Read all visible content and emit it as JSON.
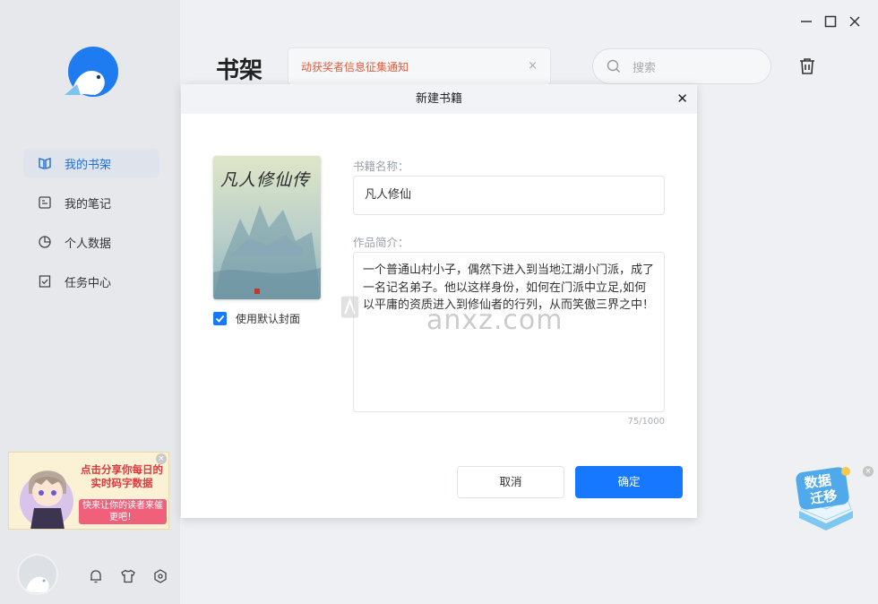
{
  "sidebar": {
    "nav": [
      {
        "label": "我的书架",
        "icon": "bookshelf-icon",
        "active": true
      },
      {
        "label": "我的笔记",
        "icon": "notes-icon",
        "active": false
      },
      {
        "label": "个人数据",
        "icon": "pie-chart-icon",
        "active": false
      },
      {
        "label": "任务中心",
        "icon": "task-icon",
        "active": false
      }
    ],
    "ad": {
      "headline": "点击分享你每日的实时码字数据",
      "button_text": "快来让你的读者来催更吧！"
    },
    "bottom_icons": [
      "bell-icon",
      "shirt-icon",
      "settings-hex-icon"
    ]
  },
  "main": {
    "title": "书架",
    "notice": "动获奖者信息征集通知",
    "search_placeholder": "搜索"
  },
  "dialog": {
    "title": "新建书籍",
    "cover_title": "凡人修仙传",
    "use_default_cover_label": "使用默认封面",
    "use_default_cover_checked": true,
    "name_label": "书籍名称：",
    "name_value": "凡人修仙",
    "intro_label": "作品简介：",
    "intro_value": "一个普通山村小子，偶然下进入到当地江湖小门派，成了一名记名弟子。他以这样身份，如何在门派中立足,如何以平庸的资质进入到修仙者的行列，从而笑傲三界之中！",
    "char_count": "75/1000",
    "cancel_label": "取消",
    "ok_label": "确定"
  },
  "migrate_badge": "数据迁移",
  "watermark": "anxz.com",
  "colors": {
    "accent": "#1677ff",
    "notice": "#e25a3a",
    "active_nav": "#1e6fd9"
  }
}
